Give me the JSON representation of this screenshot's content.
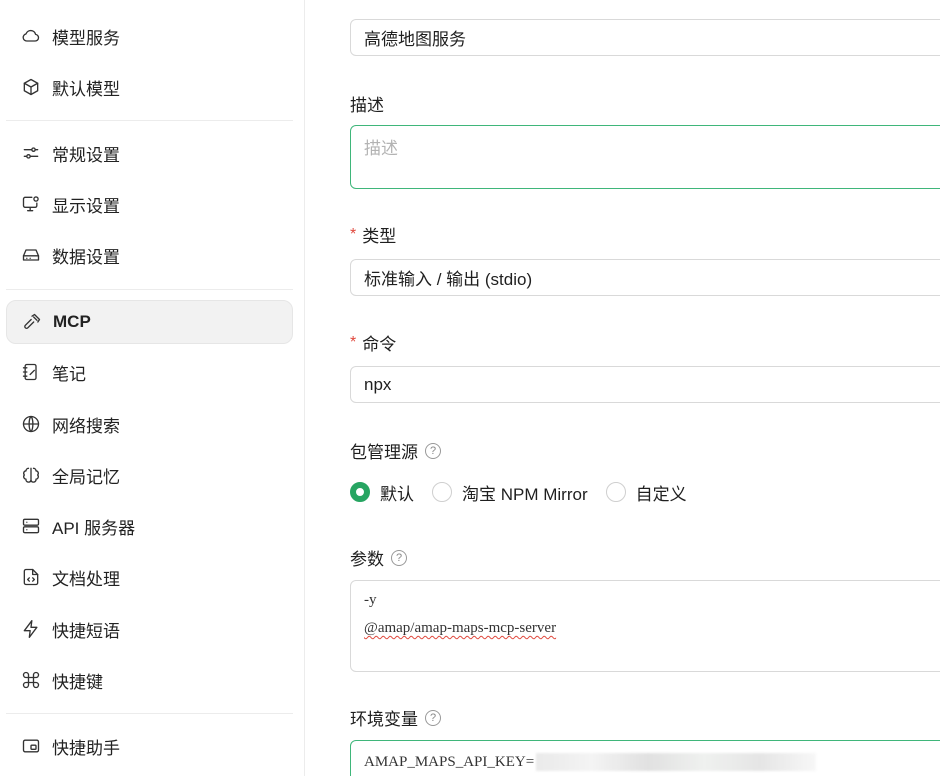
{
  "sidebar": {
    "items": [
      {
        "label": "模型服务",
        "icon": "cloud-icon"
      },
      {
        "label": "默认模型",
        "icon": "cube-icon"
      },
      {
        "label": "常规设置",
        "icon": "settings-sliders-icon"
      },
      {
        "label": "显示设置",
        "icon": "monitor-settings-icon"
      },
      {
        "label": "数据设置",
        "icon": "hard-drive-icon"
      },
      {
        "label": "MCP",
        "icon": "hammer-icon",
        "active": true
      },
      {
        "label": "笔记",
        "icon": "notebook-icon"
      },
      {
        "label": "网络搜索",
        "icon": "globe-icon"
      },
      {
        "label": "全局记忆",
        "icon": "brain-icon"
      },
      {
        "label": "API 服务器",
        "icon": "server-icon"
      },
      {
        "label": "文档处理",
        "icon": "file-code-icon"
      },
      {
        "label": "快捷短语",
        "icon": "zap-icon"
      },
      {
        "label": "快捷键",
        "icon": "command-icon"
      },
      {
        "label": "快捷助手",
        "icon": "app-window-icon"
      }
    ]
  },
  "form": {
    "name_value": "高德地图服务",
    "description": {
      "label": "描述",
      "placeholder": "描述",
      "value": ""
    },
    "type": {
      "label": "类型",
      "value": "标准输入 / 输出 (stdio)"
    },
    "command": {
      "label": "命令",
      "value": "npx"
    },
    "package_registry": {
      "label": "包管理源",
      "options": [
        "默认",
        "淘宝 NPM Mirror",
        "自定义"
      ],
      "selected": "默认"
    },
    "args": {
      "label": "参数",
      "lines": [
        "-y",
        "@amap/amap-maps-mcp-server"
      ]
    },
    "env": {
      "label": "环境变量",
      "value": "AMAP_MAPS_API_KEY="
    }
  },
  "colors": {
    "accent": "#27a562",
    "focus_border": "#3fb67a",
    "required": "#e0483d"
  }
}
